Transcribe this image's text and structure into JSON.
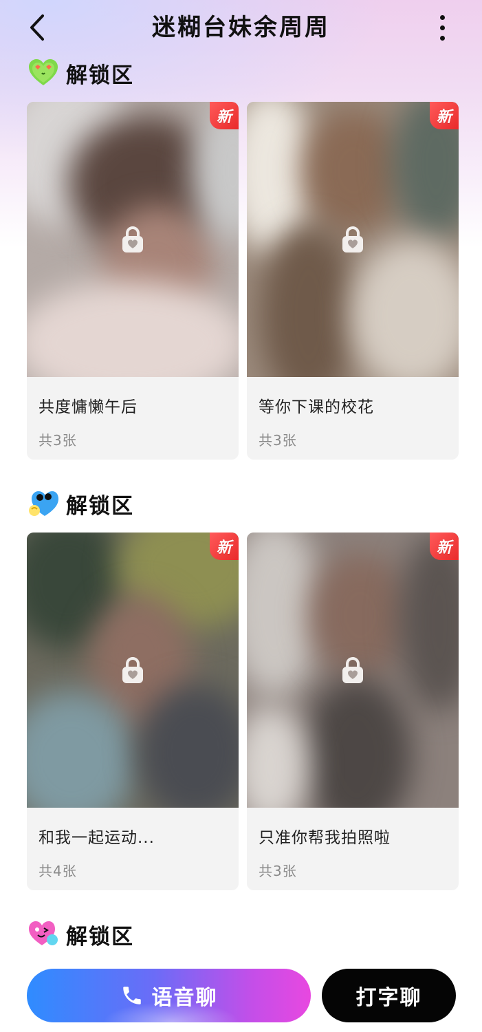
{
  "header": {
    "title": "迷糊台妹余周周",
    "back_icon": "chevron-left-icon",
    "more_icon": "more-vertical-icon"
  },
  "sections": [
    {
      "title": "解锁区",
      "icon": "green-heart-emoji-icon",
      "cards": [
        {
          "title": "共度慵懒午后",
          "count": "共3张",
          "badge": "新"
        },
        {
          "title": "等你下课的校花",
          "count": "共3张",
          "badge": "新"
        }
      ]
    },
    {
      "title": "解锁区",
      "icon": "blue-heart-emoji-icon",
      "cards": [
        {
          "title": "和我一起运动...",
          "count": "共4张",
          "badge": "新"
        },
        {
          "title": "只准你帮我拍照啦",
          "count": "共3张",
          "badge": "新"
        }
      ]
    },
    {
      "title": "解锁区",
      "icon": "pink-heart-emoji-icon"
    }
  ],
  "actions": {
    "voice_chat": "语音聊",
    "text_chat": "打字聊",
    "voice_icon": "phone-icon"
  },
  "colors": {
    "badge": "#e92a2a",
    "voice_gradient_start": "#2f8cff",
    "voice_gradient_end": "#e848e0",
    "text_button": "#050505"
  }
}
